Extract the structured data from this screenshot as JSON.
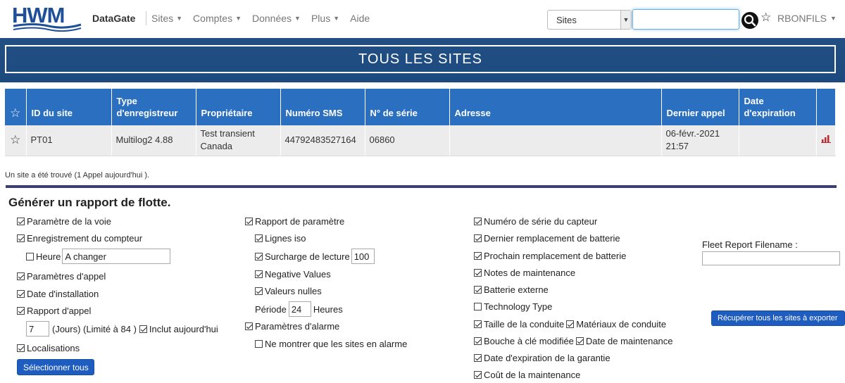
{
  "nav": {
    "brand": "DataGate",
    "items": [
      {
        "label": "Sites",
        "caret": true
      },
      {
        "label": "Comptes",
        "caret": true
      },
      {
        "label": "Données",
        "caret": true
      },
      {
        "label": "Plus",
        "caret": true
      },
      {
        "label": "Aide",
        "caret": false
      }
    ],
    "search_scope": "Sites",
    "search_value": "",
    "user": "RBONFILS"
  },
  "banner": {
    "title": "TOUS LES SITES"
  },
  "table": {
    "headers": [
      "ID du site",
      "Type d'enregistreur",
      "Propriétaire",
      "Numéro SMS",
      "N° de série",
      "Adresse",
      "Dernier appel",
      "Date d'expiration"
    ],
    "rows": [
      {
        "site_id": "PT01",
        "logger_type": "Multilog2 4.88",
        "owner": "Test transient Canada",
        "sms": "44792483527164",
        "serial": "06860",
        "address": "",
        "last_call": "06-févr.-2021 21:57",
        "expiry": ""
      }
    ]
  },
  "status_text": "Un site a été trouvé (1 Appel aujourd'hui ).",
  "report": {
    "title": "Générer un rapport de flotte.",
    "col1": {
      "voie": "Paramètre de la voie",
      "enregistrement": "Enregistrement du compteur",
      "heure_label": "Heure",
      "heure_value": "A changer",
      "params_appel": "Paramètres d'appel",
      "date_install": "Date d'installation",
      "rapport_appel": "Rapport d'appel",
      "jours_value": "7",
      "jours_label": "(Jours) (Limité à 84 )",
      "inclut": "Inclut aujourd'hui",
      "localisations": "Localisations",
      "select_all": "Sélectionner tous"
    },
    "col2": {
      "rapport_param": "Rapport de paramètre",
      "lignes_iso": "Lignes iso",
      "surcharge": "Surcharge de lecture",
      "surcharge_value": "100",
      "negative": "Negative Values",
      "nulles": "Valeurs nulles",
      "periode_label": "Période",
      "periode_value": "24",
      "heures_label": "Heures",
      "params_alarme": "Paramètres d'alarme",
      "only_alarm": "Ne montrer que les sites en alarme"
    },
    "col3": {
      "num_serie": "Numéro de série du capteur",
      "dernier_rempl": "Dernier remplacement de batterie",
      "prochain_rempl": "Prochain remplacement de batterie",
      "notes": "Notes de maintenance",
      "batterie_ext": "Batterie externe",
      "tech_type": "Technology Type",
      "taille": "Taille de la conduite",
      "materiaux": "Matériaux de conduite",
      "bouche": "Bouche à clé modifiée",
      "date_maint": "Date de maintenance",
      "garantie": "Date d'expiration de la garantie",
      "cout": "Coût de la maintenance"
    },
    "col4": {
      "filename_label": "Fleet Report Filename :",
      "filename_value": "",
      "export_button": "Récupérer tous les sites à exporter"
    }
  },
  "colors": {
    "banner": "#1c4a7f",
    "table_header": "#2a6fc0",
    "button": "#1e5dbf",
    "divider": "#3b3f78"
  }
}
